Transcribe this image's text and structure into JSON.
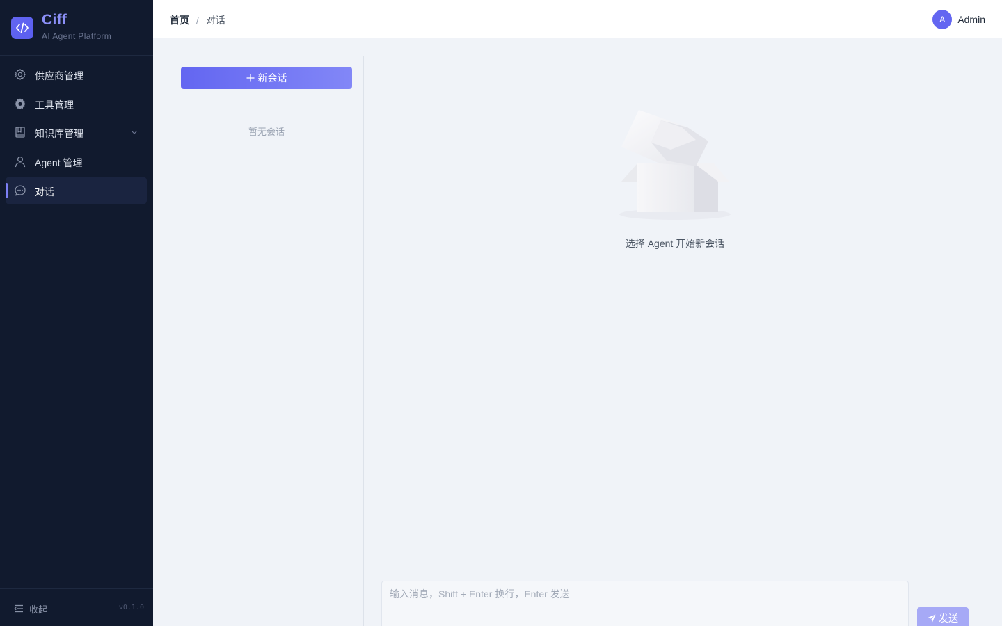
{
  "brand": {
    "name": "Ciff",
    "subtitle": "AI Agent Platform"
  },
  "sidebar": {
    "items": [
      {
        "label": "供应商管理",
        "icon": "gear-outline-icon"
      },
      {
        "label": "工具管理",
        "icon": "gear-solid-icon"
      },
      {
        "label": "知识库管理",
        "icon": "book-icon",
        "expandable": true
      },
      {
        "label": "Agent 管理",
        "icon": "user-icon"
      },
      {
        "label": "对话",
        "icon": "chat-bubble-icon",
        "active": true
      }
    ],
    "collapse_label": "收起",
    "version": "v0.1.0"
  },
  "header": {
    "breadcrumb": {
      "home": "首页",
      "separator": "/",
      "current": "对话"
    },
    "user": {
      "avatar_letter": "A",
      "name": "Admin"
    }
  },
  "conversations": {
    "new_button_label": "新会话",
    "empty_text": "暂无会话"
  },
  "chat": {
    "empty_text": "选择 Agent 开始新会话",
    "input_placeholder": "输入消息，Shift + Enter 换行，Enter 发送",
    "send_label": "发送"
  },
  "colors": {
    "sidebar_bg": "#111a2e",
    "accent": "#6366f1",
    "content_bg": "#f0f3f8"
  }
}
